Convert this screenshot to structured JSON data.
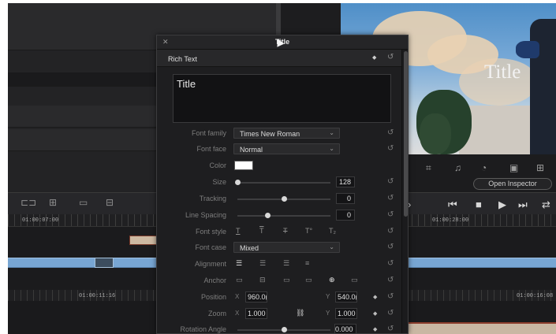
{
  "dialog": {
    "title": "Title",
    "close_icon": "close-icon",
    "section_label": "Rich Text",
    "text_content": "Title"
  },
  "properties": {
    "font_family": {
      "label": "Font family",
      "value": "Times New Roman"
    },
    "font_face": {
      "label": "Font face",
      "value": "Normal"
    },
    "color": {
      "label": "Color",
      "value": "#ffffff"
    },
    "size": {
      "label": "Size",
      "value": "128",
      "level": 0.0
    },
    "tracking": {
      "label": "Tracking",
      "value": "0",
      "level": 0.5
    },
    "line_spacing": {
      "label": "Line Spacing",
      "value": "0",
      "level": 0.32
    },
    "font_style": {
      "label": "Font style",
      "options": [
        "T",
        "T",
        "T",
        "T°",
        "T₂"
      ]
    },
    "font_case": {
      "label": "Font case",
      "value": "Mixed"
    },
    "alignment": {
      "label": "Alignment",
      "options": [
        "align-left-icon",
        "align-center-icon",
        "align-right-icon",
        "justify-icon"
      ]
    },
    "anchor": {
      "label": "Anchor",
      "options": [
        "anchor-top-icon",
        "anchor-middle-icon",
        "anchor-bottom-icon",
        "anchor-left-icon",
        "anchor-center-icon",
        "anchor-right-icon"
      ]
    },
    "position": {
      "label": "Position",
      "x_axis": "X",
      "x": "960.0(",
      "y_axis": "Y",
      "y": "540.0("
    },
    "zoom": {
      "label": "Zoom",
      "x_axis": "X",
      "x": "1.000",
      "y_axis": "Y",
      "y": "1.000"
    },
    "rotation_angle": {
      "label": "Rotation Angle",
      "value": "0.000",
      "level": 0.5
    }
  },
  "viewer": {
    "overlay_text": "Title",
    "open_inspector": "Open Inspector"
  },
  "timeline": {
    "tc_left": "01:00:07:00",
    "tc_right": "01:00:28:00",
    "tc_mid": "01:00:11:16",
    "tc_far_right": "01:00:16:08"
  },
  "colors": {
    "clip_video": "#78a6d3",
    "clip_title": "#cdb9a2",
    "panel_bg": "#1e1e20"
  }
}
